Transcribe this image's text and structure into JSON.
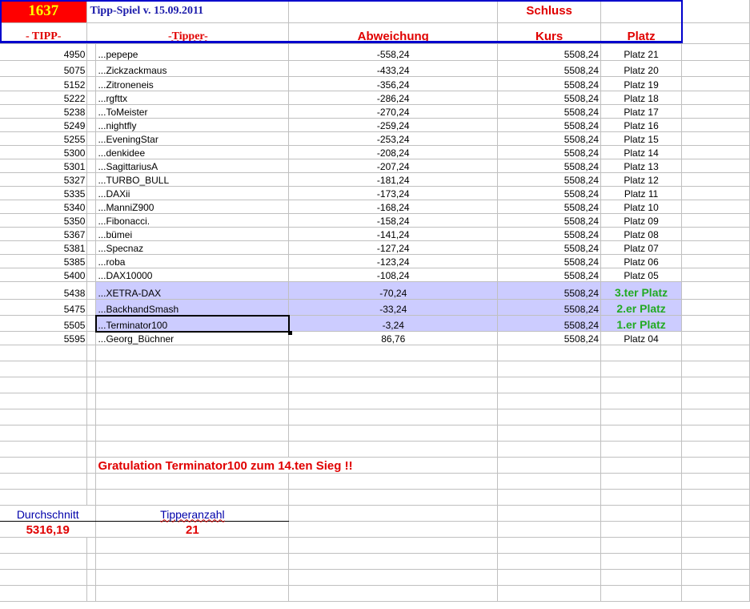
{
  "header": {
    "count": "1637",
    "title": "Tipp-Spiel v. 15.09.2011",
    "schluss": "Schluss",
    "col_tipp": "- TIPP-",
    "col_tipper": "-Tipper-",
    "col_abweichung": "Abweichung",
    "col_kurs": "Kurs",
    "col_platz": "Platz"
  },
  "rows": [
    {
      "tipp": "4950",
      "tipper": "...pepepe",
      "abw": "-558,24",
      "kurs": "5508,24",
      "platz": "Platz 21"
    },
    {
      "tipp": "5075",
      "tipper": "...Zickzackmaus",
      "abw": "-433,24",
      "kurs": "5508,24",
      "platz": "Platz 20"
    },
    {
      "tipp": "5152",
      "tipper": "...Zitroneneis",
      "abw": "-356,24",
      "kurs": "5508,24",
      "platz": "Platz 19"
    },
    {
      "tipp": "5222",
      "tipper": "...rgfttx",
      "abw": "-286,24",
      "kurs": "5508,24",
      "platz": "Platz 18"
    },
    {
      "tipp": "5238",
      "tipper": "...ToMeister",
      "abw": "-270,24",
      "kurs": "5508,24",
      "platz": "Platz 17"
    },
    {
      "tipp": "5249",
      "tipper": "...nightfly",
      "abw": "-259,24",
      "kurs": "5508,24",
      "platz": "Platz 16"
    },
    {
      "tipp": "5255",
      "tipper": "...EveningStar",
      "abw": "-253,24",
      "kurs": "5508,24",
      "platz": "Platz 15"
    },
    {
      "tipp": "5300",
      "tipper": "...denkidee",
      "abw": "-208,24",
      "kurs": "5508,24",
      "platz": "Platz 14"
    },
    {
      "tipp": "5301",
      "tipper": "...SagittariusA",
      "abw": "-207,24",
      "kurs": "5508,24",
      "platz": "Platz 13"
    },
    {
      "tipp": "5327",
      "tipper": "...TURBO_BULL",
      "abw": "-181,24",
      "kurs": "5508,24",
      "platz": "Platz 12"
    },
    {
      "tipp": "5335",
      "tipper": "...DAXii",
      "abw": "-173,24",
      "kurs": "5508,24",
      "platz": "Platz 11"
    },
    {
      "tipp": "5340",
      "tipper": "...ManniZ900",
      "abw": "-168,24",
      "kurs": "5508,24",
      "platz": "Platz 10"
    },
    {
      "tipp": "5350",
      "tipper": "...Fibonacci.",
      "abw": "-158,24",
      "kurs": "5508,24",
      "platz": "Platz 09"
    },
    {
      "tipp": "5367",
      "tipper": "...bümei",
      "abw": "-141,24",
      "kurs": "5508,24",
      "platz": "Platz 08"
    },
    {
      "tipp": "5381",
      "tipper": "...Specnaz",
      "abw": "-127,24",
      "kurs": "5508,24",
      "platz": "Platz 07"
    },
    {
      "tipp": "5385",
      "tipper": "...roba",
      "abw": "-123,24",
      "kurs": "5508,24",
      "platz": "Platz 06"
    },
    {
      "tipp": "5400",
      "tipper": "...DAX10000",
      "abw": "-108,24",
      "kurs": "5508,24",
      "platz": "Platz 05"
    },
    {
      "tipp": "5438",
      "tipper": "...XETRA-DAX",
      "abw": "-70,24",
      "kurs": "5508,24",
      "platz": "3.ter Platz",
      "top": true
    },
    {
      "tipp": "5475",
      "tipper": "...BackhandSmash",
      "abw": "-33,24",
      "kurs": "5508,24",
      "platz": "2.er Platz",
      "top": true
    },
    {
      "tipp": "5505",
      "tipper": "...Terminator100",
      "abw": "-3,24",
      "kurs": "5508,24",
      "platz": "1.er Platz",
      "top": true
    },
    {
      "tipp": "5595",
      "tipper": "...Georg_Büchner",
      "abw": "86,76",
      "kurs": "5508,24",
      "platz": "Platz 04"
    }
  ],
  "footer": {
    "congrats": "Gratulation Terminator100 zum 14.ten Sieg !!",
    "avg_label": "Durchschnitt",
    "avg_value": "5316,19",
    "count_label": "Tipperanzahl",
    "count_value": "21"
  },
  "colors": {
    "highlight": "#ccccff",
    "accent_red": "#e00000",
    "green": "#22aa22",
    "blue": "#0000cc"
  }
}
